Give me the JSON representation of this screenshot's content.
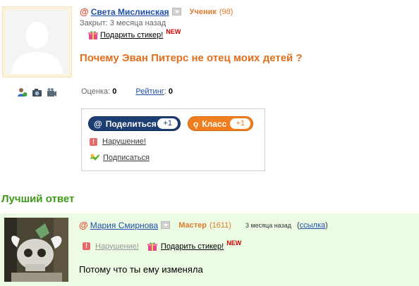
{
  "question": {
    "author_name": "Света Мислинская",
    "author_rank": "Ученик",
    "author_points": "(98)",
    "status": "Закрыт: 3 месяца назад",
    "gift_label": "Подарить стикер!",
    "new_badge": "NEW",
    "title": "Почему Эван Питерс не отец моих детей ?",
    "score_label": "Оценка:",
    "score_value": "0",
    "rating_label": "Рейтинг",
    "rating_colon": ":",
    "rating_value": "0"
  },
  "share": {
    "mail_label": "Поделиться",
    "mail_count": "+1",
    "ok_label": "Класс",
    "ok_count": "+1",
    "violation_label": "Нарушение!",
    "subscribe_label": "Подписаться"
  },
  "best_answer": {
    "heading": "Лучший ответ",
    "author_name": "Мария Смирнова",
    "author_rank": "Мастер",
    "author_points": "(1611)",
    "time": "3 месяца назад",
    "link_open": "(",
    "link_label": "ссылка",
    "link_close": ")",
    "violation_label": "Нарушение!",
    "gift_label": "Подарить стикер!",
    "new_badge": "NEW",
    "text": "Потому что ты ему изменяла"
  },
  "colors": {
    "accent_orange": "#e46e1c",
    "link_blue": "#1f4fa7",
    "best_green": "#3d9a16",
    "answer_bg": "#ecfbe3"
  }
}
